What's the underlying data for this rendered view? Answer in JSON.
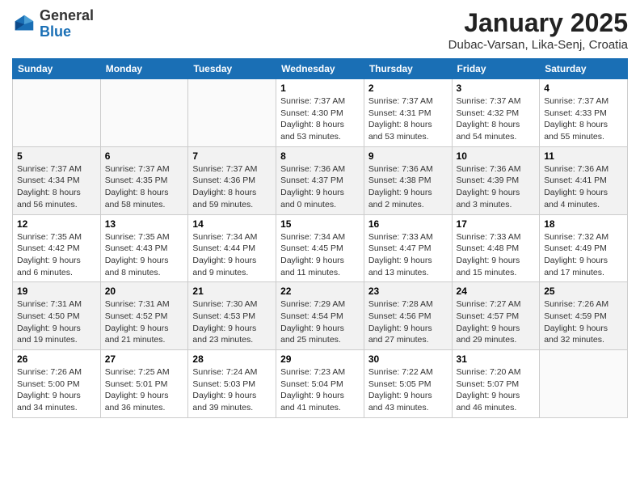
{
  "logo": {
    "general": "General",
    "blue": "Blue"
  },
  "title": "January 2025",
  "subtitle": "Dubac-Varsan, Lika-Senj, Croatia",
  "weekdays": [
    "Sunday",
    "Monday",
    "Tuesday",
    "Wednesday",
    "Thursday",
    "Friday",
    "Saturday"
  ],
  "weeks": [
    [
      {
        "day": null,
        "info": null
      },
      {
        "day": null,
        "info": null
      },
      {
        "day": null,
        "info": null
      },
      {
        "day": "1",
        "info": "Sunrise: 7:37 AM\nSunset: 4:30 PM\nDaylight: 8 hours\nand 53 minutes."
      },
      {
        "day": "2",
        "info": "Sunrise: 7:37 AM\nSunset: 4:31 PM\nDaylight: 8 hours\nand 53 minutes."
      },
      {
        "day": "3",
        "info": "Sunrise: 7:37 AM\nSunset: 4:32 PM\nDaylight: 8 hours\nand 54 minutes."
      },
      {
        "day": "4",
        "info": "Sunrise: 7:37 AM\nSunset: 4:33 PM\nDaylight: 8 hours\nand 55 minutes."
      }
    ],
    [
      {
        "day": "5",
        "info": "Sunrise: 7:37 AM\nSunset: 4:34 PM\nDaylight: 8 hours\nand 56 minutes."
      },
      {
        "day": "6",
        "info": "Sunrise: 7:37 AM\nSunset: 4:35 PM\nDaylight: 8 hours\nand 58 minutes."
      },
      {
        "day": "7",
        "info": "Sunrise: 7:37 AM\nSunset: 4:36 PM\nDaylight: 8 hours\nand 59 minutes."
      },
      {
        "day": "8",
        "info": "Sunrise: 7:36 AM\nSunset: 4:37 PM\nDaylight: 9 hours\nand 0 minutes."
      },
      {
        "day": "9",
        "info": "Sunrise: 7:36 AM\nSunset: 4:38 PM\nDaylight: 9 hours\nand 2 minutes."
      },
      {
        "day": "10",
        "info": "Sunrise: 7:36 AM\nSunset: 4:39 PM\nDaylight: 9 hours\nand 3 minutes."
      },
      {
        "day": "11",
        "info": "Sunrise: 7:36 AM\nSunset: 4:41 PM\nDaylight: 9 hours\nand 4 minutes."
      }
    ],
    [
      {
        "day": "12",
        "info": "Sunrise: 7:35 AM\nSunset: 4:42 PM\nDaylight: 9 hours\nand 6 minutes."
      },
      {
        "day": "13",
        "info": "Sunrise: 7:35 AM\nSunset: 4:43 PM\nDaylight: 9 hours\nand 8 minutes."
      },
      {
        "day": "14",
        "info": "Sunrise: 7:34 AM\nSunset: 4:44 PM\nDaylight: 9 hours\nand 9 minutes."
      },
      {
        "day": "15",
        "info": "Sunrise: 7:34 AM\nSunset: 4:45 PM\nDaylight: 9 hours\nand 11 minutes."
      },
      {
        "day": "16",
        "info": "Sunrise: 7:33 AM\nSunset: 4:47 PM\nDaylight: 9 hours\nand 13 minutes."
      },
      {
        "day": "17",
        "info": "Sunrise: 7:33 AM\nSunset: 4:48 PM\nDaylight: 9 hours\nand 15 minutes."
      },
      {
        "day": "18",
        "info": "Sunrise: 7:32 AM\nSunset: 4:49 PM\nDaylight: 9 hours\nand 17 minutes."
      }
    ],
    [
      {
        "day": "19",
        "info": "Sunrise: 7:31 AM\nSunset: 4:50 PM\nDaylight: 9 hours\nand 19 minutes."
      },
      {
        "day": "20",
        "info": "Sunrise: 7:31 AM\nSunset: 4:52 PM\nDaylight: 9 hours\nand 21 minutes."
      },
      {
        "day": "21",
        "info": "Sunrise: 7:30 AM\nSunset: 4:53 PM\nDaylight: 9 hours\nand 23 minutes."
      },
      {
        "day": "22",
        "info": "Sunrise: 7:29 AM\nSunset: 4:54 PM\nDaylight: 9 hours\nand 25 minutes."
      },
      {
        "day": "23",
        "info": "Sunrise: 7:28 AM\nSunset: 4:56 PM\nDaylight: 9 hours\nand 27 minutes."
      },
      {
        "day": "24",
        "info": "Sunrise: 7:27 AM\nSunset: 4:57 PM\nDaylight: 9 hours\nand 29 minutes."
      },
      {
        "day": "25",
        "info": "Sunrise: 7:26 AM\nSunset: 4:59 PM\nDaylight: 9 hours\nand 32 minutes."
      }
    ],
    [
      {
        "day": "26",
        "info": "Sunrise: 7:26 AM\nSunset: 5:00 PM\nDaylight: 9 hours\nand 34 minutes."
      },
      {
        "day": "27",
        "info": "Sunrise: 7:25 AM\nSunset: 5:01 PM\nDaylight: 9 hours\nand 36 minutes."
      },
      {
        "day": "28",
        "info": "Sunrise: 7:24 AM\nSunset: 5:03 PM\nDaylight: 9 hours\nand 39 minutes."
      },
      {
        "day": "29",
        "info": "Sunrise: 7:23 AM\nSunset: 5:04 PM\nDaylight: 9 hours\nand 41 minutes."
      },
      {
        "day": "30",
        "info": "Sunrise: 7:22 AM\nSunset: 5:05 PM\nDaylight: 9 hours\nand 43 minutes."
      },
      {
        "day": "31",
        "info": "Sunrise: 7:20 AM\nSunset: 5:07 PM\nDaylight: 9 hours\nand 46 minutes."
      },
      {
        "day": null,
        "info": null
      }
    ]
  ]
}
